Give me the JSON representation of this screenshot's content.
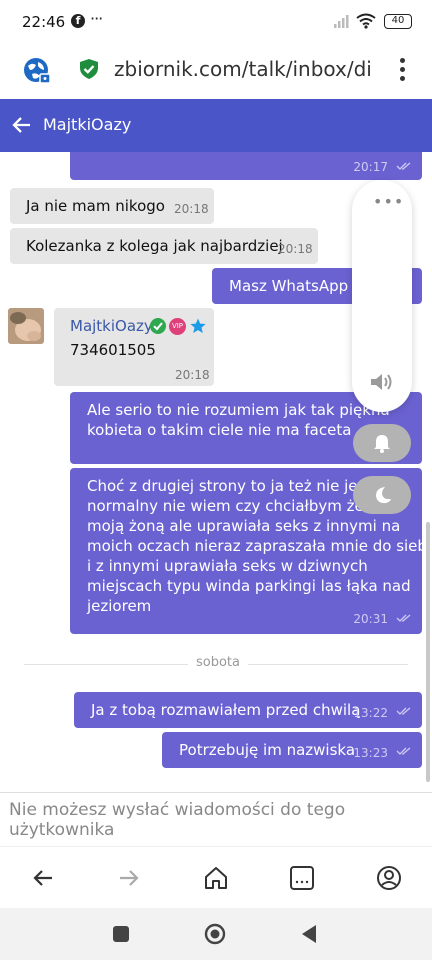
{
  "status_bar": {
    "time": "22:46",
    "more": "···",
    "battery": "40"
  },
  "browser": {
    "url": "zbiornik.com/talk/inbox/dialog"
  },
  "header": {
    "contact_name": "MajtkiOazy"
  },
  "messages": [
    {
      "dir": "out",
      "text": "",
      "time": "20:17"
    },
    {
      "dir": "in",
      "text": "Ja nie mam nikogo",
      "time": "20:18"
    },
    {
      "dir": "in",
      "text": "Kolezanka z kolega jak najbardziej",
      "time": "20:18"
    },
    {
      "dir": "out",
      "text": "Masz WhatsApp",
      "time": ""
    },
    {
      "dir": "in",
      "sender": "MajtkiOazy",
      "vip": "VIP",
      "text": "734601505",
      "time": "20:18"
    },
    {
      "dir": "out",
      "lines": [
        "Ale serio to nie rozumiem jak tak piękna",
        "kobieta o takim ciele nie ma faceta"
      ],
      "time": ""
    },
    {
      "dir": "out",
      "lines": [
        "Choć z drugiej strony to ja też nie jestem",
        "normalny nie wiem czy chciałbym żebyś",
        "moją żoną ale uprawiała seks z innymi na",
        "moich oczach nieraz zapraszała mnie do siebie",
        "i z innymi uprawiała seks w dziwnych",
        "miejscach typu winda parkingi las łąka nad",
        "jeziorem"
      ],
      "time": "20:31"
    },
    {
      "dir": "out",
      "text": "Ja z tobą rozmawiałem przed chwilą",
      "time": "13:22"
    },
    {
      "dir": "out",
      "text": "Potrzebuję im nazwiska",
      "time": "13:23"
    }
  ],
  "date_separator": "sobota",
  "volume_overlay": {
    "more": "•••"
  },
  "footer": {
    "notice": "Nie możesz wysłać wiadomości do tego użytkownika"
  },
  "colors": {
    "header": "#4a55c8",
    "outgoing": "#6b62d2",
    "incoming": "#e6e6e6"
  }
}
